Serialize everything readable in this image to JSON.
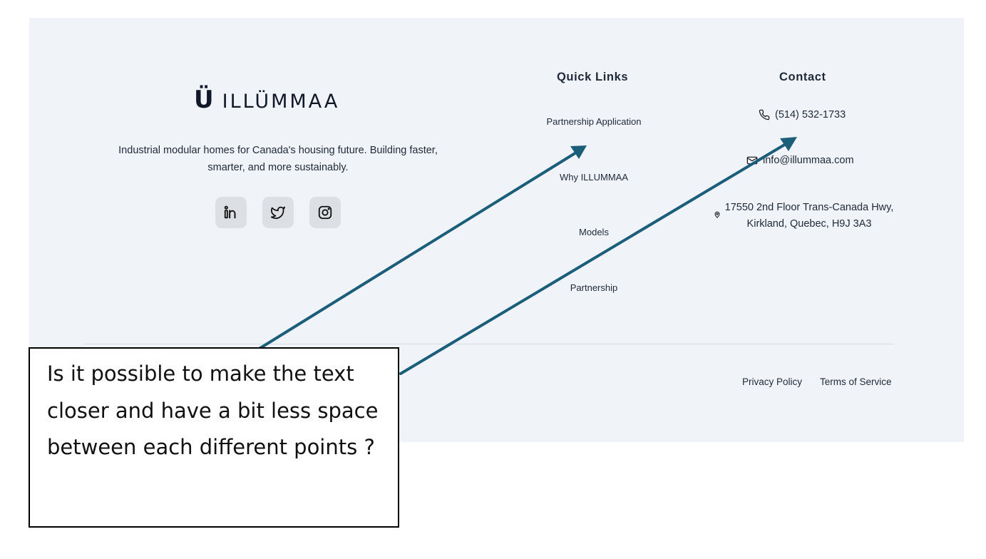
{
  "brand": {
    "logo_mark": "Ü",
    "logo_text": "ILLÜMMAA"
  },
  "tagline": "Industrial modular homes for Canada's housing future. Building faster, smarter, and more sustainably.",
  "social": [
    {
      "name": "linkedin-icon"
    },
    {
      "name": "twitter-icon"
    },
    {
      "name": "instagram-icon"
    }
  ],
  "quick_links": {
    "title": "Quick Links",
    "items": [
      "Partnership Application",
      "Why ILLUMMAA",
      "Models",
      "Partnership"
    ]
  },
  "contact": {
    "title": "Contact",
    "phone": "(514) 532-1733",
    "email": "info@illummaa.com",
    "address": "17550 2nd Floor Trans-Canada Hwy, Kirkland, Quebec, H9J 3A3"
  },
  "legal": {
    "privacy": "Privacy Policy",
    "terms": "Terms of Service"
  },
  "annotation": {
    "text": "Is it possible to make the text closer  and have a bit less space between each different points ?",
    "arrow_color": "#1b5e7a"
  },
  "colors": {
    "footer_bg": "#f0f3f8",
    "social_bg": "#dcdfe3"
  }
}
